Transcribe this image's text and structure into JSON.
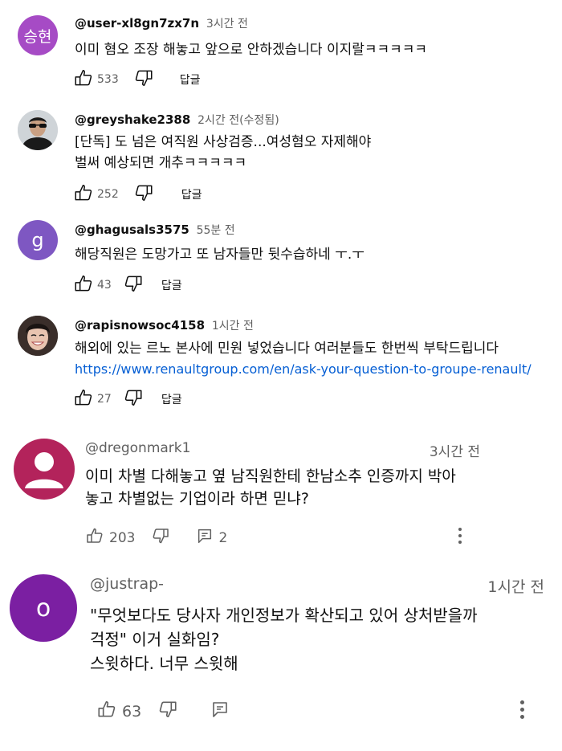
{
  "comments": [
    {
      "avatar_letter": "승현",
      "avatar_color": "#a64bc5",
      "handle": "@user-xl8gn7zx7n",
      "time": "3시간 전",
      "lines": [
        "이미 혐오 조장 해놓고 앞으로 안하겠습니다 이지랄ㅋㅋㅋㅋㅋ"
      ],
      "likes": "533",
      "reply": "답글"
    },
    {
      "avatar_icon": "profile-photo-sunglasses",
      "handle": "@greyshake2388",
      "time": "2시간 전(수정됨)",
      "lines": [
        "[단독] 도 넘은 여직원 사상검증...여성혐오 자제해야",
        "벌써 예상되면 개추ㅋㅋㅋㅋㅋ"
      ],
      "likes": "252",
      "reply": "답글"
    },
    {
      "avatar_letter": "g",
      "avatar_color": "#7e57c2",
      "handle": "@ghagusals3575",
      "time": "55분 전",
      "lines": [
        "해당직원은 도망가고 또 남자들만 뒷수습하네 ㅜ.ㅜ"
      ],
      "likes": "43",
      "reply": "답글"
    },
    {
      "avatar_icon": "profile-photo-smiling-woman",
      "handle": "@rapisnowsoc4158",
      "time": "1시간 전",
      "lines": [
        "해외에 있는 르노 본사에 민원 넣었습니다 여러분들도 한번씩 부탁드립니다"
      ],
      "link": "https://www.renaultgroup.com/en/ask-your-question-to-groupe-renault/",
      "likes": "27",
      "reply": "답글"
    },
    {
      "avatar_icon": "default-person-icon",
      "avatar_color": "#b3235b",
      "handle": "@dregonmark1",
      "time": "3시간 전",
      "lines": [
        "이미 차별 다해놓고 옆 남직원한테 한남소추 인증까지 박아",
        "놓고 차별없는 기업이라 하면 믿냐?"
      ],
      "likes": "203",
      "replies": "2"
    },
    {
      "avatar_letter": "o",
      "avatar_color": "#7b1fa2",
      "handle": "@justrap-",
      "time": "1시간 전",
      "lines": [
        "\"무엇보다도 당사자 개인정보가 확산되고 있어 상처받을까",
        "걱정\" 이거 실화임?",
        "스윗하다. 너무 스윗해"
      ],
      "likes": "63"
    }
  ]
}
